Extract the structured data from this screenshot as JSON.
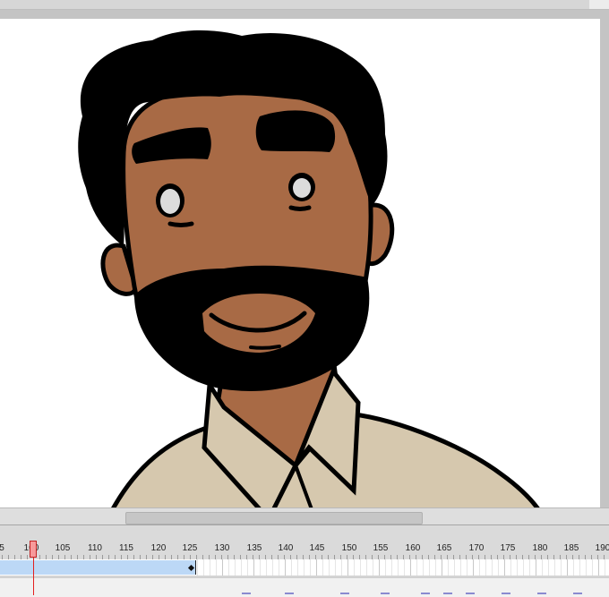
{
  "app": {
    "name": ""
  },
  "timeline": {
    "playhead_frame": 100,
    "tween_end_frame": 126,
    "ruler_labels": [
      "5",
      "100",
      "105",
      "110",
      "115",
      "120",
      "125",
      "130",
      "135",
      "140",
      "145",
      "150",
      "155",
      "160",
      "165",
      "170",
      "175",
      "180",
      "185",
      "190"
    ]
  },
  "canvas": {
    "description_icon": "character-drawing",
    "colors": {
      "skin": "#a86a45",
      "hair": "#000000",
      "shirt": "#d6c8ae",
      "eye": "#dcdcdc"
    }
  }
}
